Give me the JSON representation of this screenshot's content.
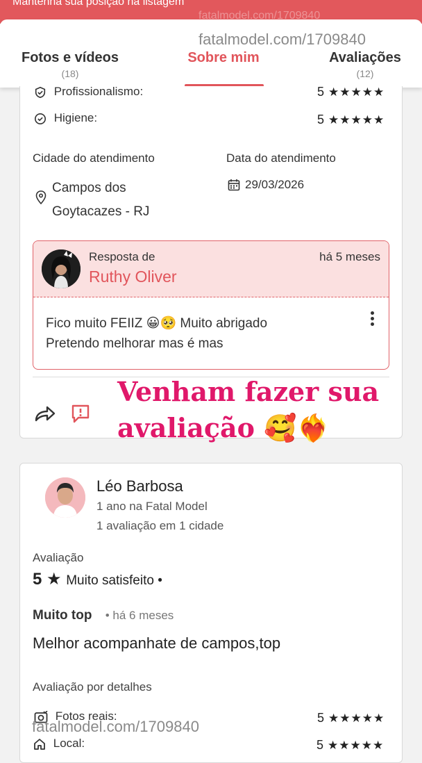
{
  "banner": {
    "text": "Mantenha sua posição na listagem",
    "watermark": "fatalmodel.com/1709840"
  },
  "watermark_top": "fatalmodel.com/1709840",
  "watermark_bottom": "fatalmodel.com/1709840",
  "tabs": [
    {
      "label": "Fotos e vídeos",
      "count": "(18)"
    },
    {
      "label": "Sobre mim",
      "count": ""
    },
    {
      "label": "Avaliações",
      "count": "(12)"
    }
  ],
  "review1": {
    "details": [
      {
        "label": "Profissionalismo:",
        "score": "5",
        "stars": "★★★★★",
        "icon": "shield-check-icon"
      },
      {
        "label": "Higiene:",
        "score": "5",
        "stars": "★★★★★",
        "icon": "check-circle-icon"
      }
    ],
    "city_label": "Cidade do atendimento",
    "city_value_line1": "Campos dos",
    "city_value_line2": "Goytacazes - RJ",
    "date_label": "Data do atendimento",
    "date_value": "29/03/2026",
    "response": {
      "prefix": "Resposta de",
      "name": "Ruthy Oliver",
      "time": "há 5 meses",
      "text_line1": "Fico muito FEIIZ 😀🥺 Muito abrigado",
      "text_line2": "Pretendo melhorar mas é mas"
    },
    "promo_line1": "Venham fazer sua",
    "promo_line2": "avaliação 🥰❤️‍🔥"
  },
  "review2": {
    "user_name": "Léo Barbosa",
    "member_since": "1 ano na Fatal Model",
    "reviews_count": "1 avaliação em 1 cidade",
    "rating_label": "Avaliação",
    "rating_value": "5",
    "rating_star": "★",
    "rating_text": "Muito satisfeito •",
    "title": "Muito top",
    "time": "•  há 6 meses",
    "body": "Melhor acompanhate de campos,top",
    "details_label": "Avaliação por detalhes",
    "details": [
      {
        "label": "Fotos reais:",
        "score": "5",
        "stars": "★★★★★",
        "icon": "camera-check-icon"
      },
      {
        "label": "Local:",
        "score": "5",
        "stars": "★★★★★",
        "icon": "home-icon"
      }
    ]
  },
  "colors": {
    "accent": "#e1555b",
    "promo": "#e0186a",
    "banner": "#e2585c"
  }
}
